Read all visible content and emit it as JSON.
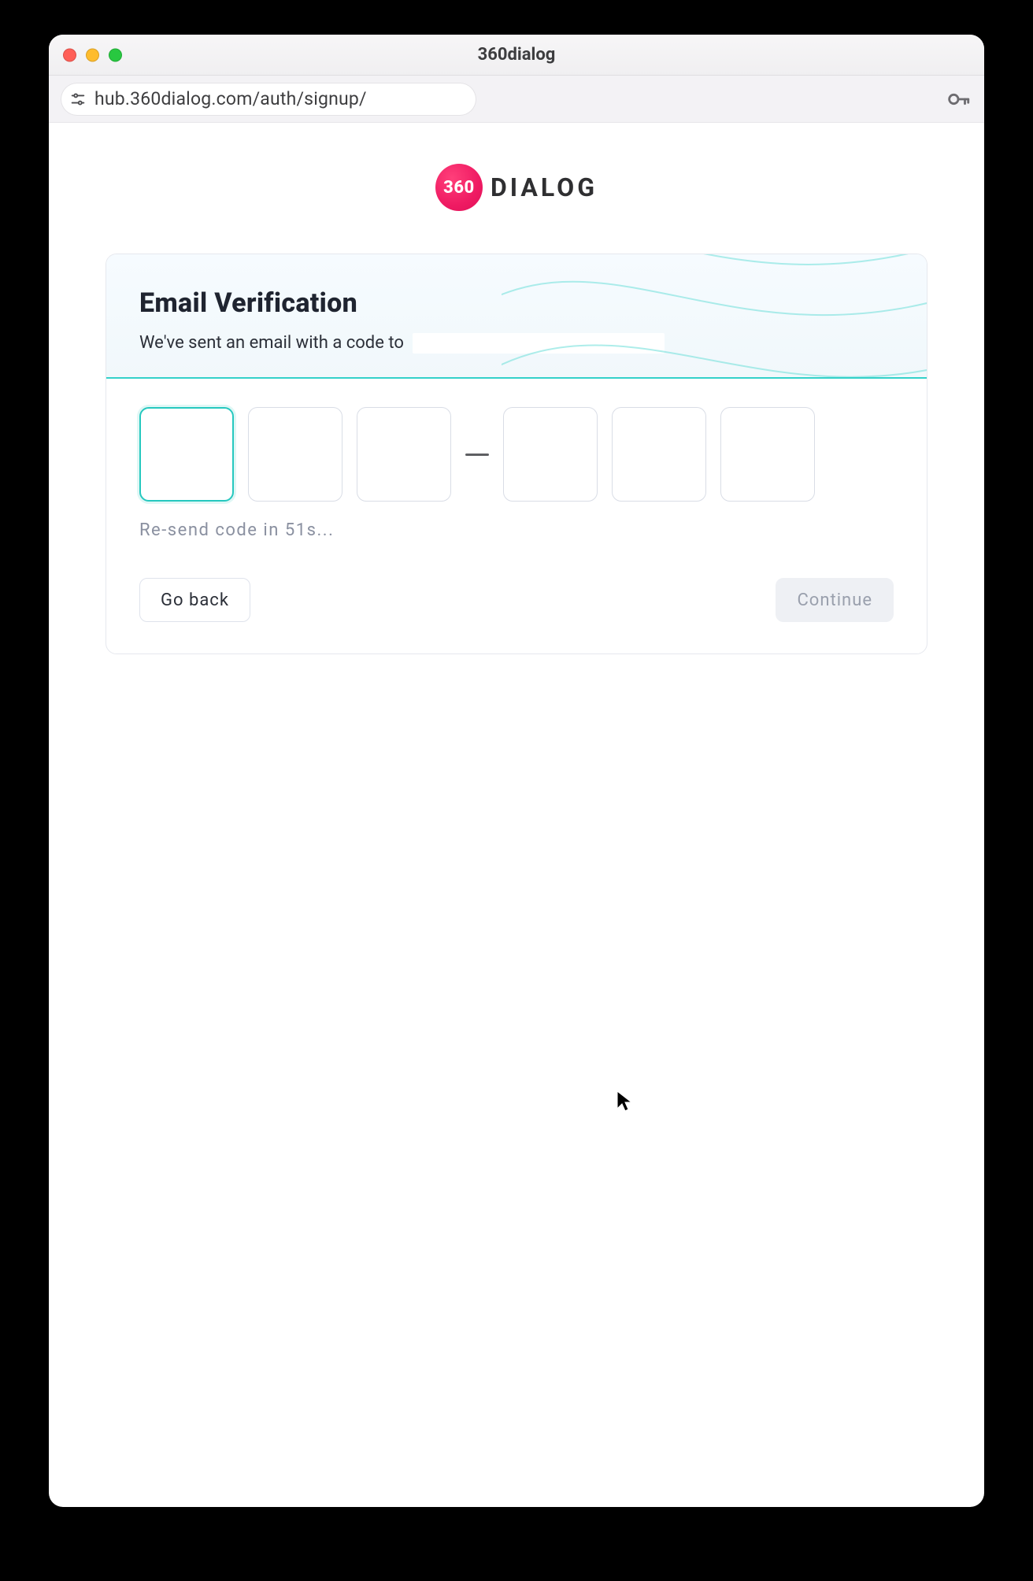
{
  "window": {
    "title": "360dialog",
    "url": "hub.360dialog.com/auth/signup/"
  },
  "brand": {
    "badge_text": "360",
    "word": "DIALOG"
  },
  "header": {
    "title": "Email Verification",
    "subtitle_prefix": "We've sent an email with a code to"
  },
  "otp": {
    "values": [
      "",
      "",
      "",
      "",
      "",
      ""
    ],
    "resend_text": "Re-send code in 51s..."
  },
  "actions": {
    "go_back": "Go back",
    "continue": "Continue"
  },
  "icons": {
    "tune": "tune-icon",
    "key": "key-icon"
  },
  "colors": {
    "accent": "#26c8bf",
    "brand_pink": "#ef1b63"
  }
}
